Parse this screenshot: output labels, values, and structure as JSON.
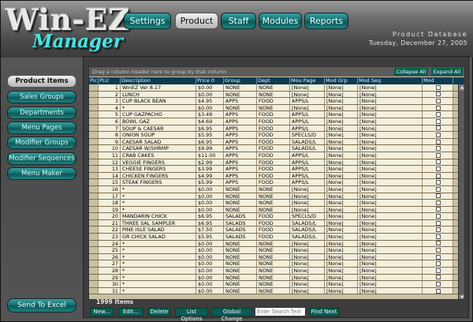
{
  "logo": {
    "main": "Win-EZ",
    "sub": "Manager"
  },
  "nav": [
    {
      "label": "Settings"
    },
    {
      "label": "Product"
    },
    {
      "label": "Staff"
    },
    {
      "label": "Modules"
    },
    {
      "label": "Reports"
    }
  ],
  "header": {
    "db_title": "Product Database",
    "date": "Tuesday, December 27, 2005"
  },
  "sidebar": [
    {
      "label": "Product Items"
    },
    {
      "label": "Sales Groups"
    },
    {
      "label": "Departments"
    },
    {
      "label": "Menu Pages"
    },
    {
      "label": "Modifier Groups"
    },
    {
      "label": "Modifier Sequences"
    },
    {
      "label": "Menu Maker"
    }
  ],
  "send_excel": "Send To Excel",
  "grid": {
    "group_hint": "Drag a column header here to group by that column",
    "collapse_all": "Collapse All",
    "expand_all": "Expand All",
    "columns": [
      "Pic",
      "PLU",
      "Description",
      "Price 0",
      "Group",
      "Dept",
      "Mou Page",
      "Mod Grp",
      "Mod Seq",
      "Mod"
    ],
    "rows": [
      [
        "1",
        "WinEZ  Ver 8.17",
        "$0.00",
        "NONE",
        "NONE",
        "[None]",
        "[None]",
        "[None]"
      ],
      [
        "2",
        "LUNCH",
        "$0.00",
        "NONE",
        "NONE",
        "[None]",
        "[None]",
        "[None]"
      ],
      [
        "3",
        "CUP BLACK BEAN",
        "$4.95",
        "APPS",
        "FOOD",
        "APPS/L",
        "[None]",
        "[None]"
      ],
      [
        "4",
        "*",
        "$0.00",
        "NONE",
        "NONE",
        "[None]",
        "[None]",
        "[None]"
      ],
      [
        "5",
        "CUP GAZPACHO",
        "$3.49",
        "APPS",
        "FOOD",
        "APPS/L",
        "[None]",
        "[None]"
      ],
      [
        "6",
        "BOWL GAZ",
        "$4.69",
        "APPS",
        "FOOD",
        "APPS/L",
        "[None]",
        "[None]"
      ],
      [
        "7",
        "SOUP & CAESAR",
        "$6.95",
        "APPS",
        "FOOD",
        "APPS/L",
        "[None]",
        "[None]"
      ],
      [
        "8",
        "ONION SOUP",
        "$5.95",
        "APPS",
        "FOOD",
        "SPECLS/D",
        "[None]",
        "[None]"
      ],
      [
        "9",
        "CAESAR SALAD",
        "$6.95",
        "APPS",
        "FOOD",
        "SALADS/L",
        "[None]",
        "[None]"
      ],
      [
        "10",
        "CAESAR W/SHRMP",
        "$9.99",
        "APPS",
        "FOOD",
        "SALADS/L",
        "[None]",
        "[None]"
      ],
      [
        "11",
        "CRAB CAKES",
        "$11.00",
        "APPS",
        "FOOD",
        "APPS/L",
        "[None]",
        "[None]"
      ],
      [
        "12",
        "VEGGIE FINGERS",
        "$2.99",
        "APPS",
        "FOOD",
        "APPS/L",
        "[None]",
        "[None]"
      ],
      [
        "13",
        "CHEESE FINGERS",
        "$3.99",
        "APPS",
        "FOOD",
        "APPS/L",
        "[None]",
        "[None]"
      ],
      [
        "14",
        "CHICKEN FINGERS",
        "$4.99",
        "APPS",
        "FOOD",
        "APPS/L",
        "[None]",
        "[None]"
      ],
      [
        "15",
        "STEAK FINGERS",
        "$5.99",
        "APPS",
        "FOOD",
        "APPS/L",
        "[None]",
        "[None]"
      ],
      [
        "16",
        "*",
        "$0.00",
        "NONE",
        "NONE",
        "[None]",
        "[None]",
        "[None]"
      ],
      [
        "17",
        "*",
        "$0.00",
        "NONE",
        "NONE",
        "[None]",
        "[None]",
        "[None]"
      ],
      [
        "18",
        "*",
        "$0.00",
        "NONE",
        "NONE",
        "[None]",
        "[None]",
        "[None]"
      ],
      [
        "19",
        "*",
        "$0.00",
        "NONE",
        "NONE",
        "[None]",
        "[None]",
        "[None]"
      ],
      [
        "20",
        "MANDARIN CHICK",
        "$6.95",
        "SALADS",
        "FOOD",
        "SPECLS/D",
        "[None]",
        "[None]"
      ],
      [
        "21",
        "THREE SAL SAMPLER",
        "$6.95",
        "SALADS",
        "FOOD",
        "SALADS/L",
        "[None]",
        "[None]"
      ],
      [
        "22",
        "PINE ISLE SALAD",
        "$7.50",
        "SALADS",
        "FOOD",
        "SALADS/L",
        "[None]",
        "[None]"
      ],
      [
        "23",
        "GR CHICK SALAD",
        "$5.95",
        "SALADS",
        "FOOD",
        "SALADS/L",
        "[None]",
        "[None]"
      ],
      [
        "24",
        "*",
        "$0.00",
        "NONE",
        "NONE",
        "[None]",
        "[None]",
        "[None]"
      ],
      [
        "25",
        "*",
        "$0.00",
        "NONE",
        "NONE",
        "[None]",
        "[None]",
        "[None]"
      ],
      [
        "26",
        "*",
        "$0.00",
        "NONE",
        "NONE",
        "[None]",
        "[None]",
        "[None]"
      ],
      [
        "27",
        "*",
        "$0.00",
        "NONE",
        "NONE",
        "[None]",
        "[None]",
        "[None]"
      ],
      [
        "28",
        "*",
        "$0.00",
        "NONE",
        "NONE",
        "[None]",
        "[None]",
        "[None]"
      ],
      [
        "29",
        "*",
        "$0.00",
        "NONE",
        "NONE",
        "[None]",
        "[None]",
        "[None]"
      ],
      [
        "30",
        "*",
        "$0.00",
        "NONE",
        "NONE",
        "[None]",
        "[None]",
        "[None]"
      ],
      [
        "31",
        "*",
        "$0.00",
        "NONE",
        "NONE",
        "[None]",
        "[None]",
        "[None]"
      ]
    ]
  },
  "footer": {
    "count": "1999 Items",
    "new": "New...",
    "edit": "Edit...",
    "delete": "Delete",
    "list_options": "List Options",
    "global_change": "Global Change",
    "search_placeholder": "Enter Search Text",
    "find_next": "Find Next"
  }
}
